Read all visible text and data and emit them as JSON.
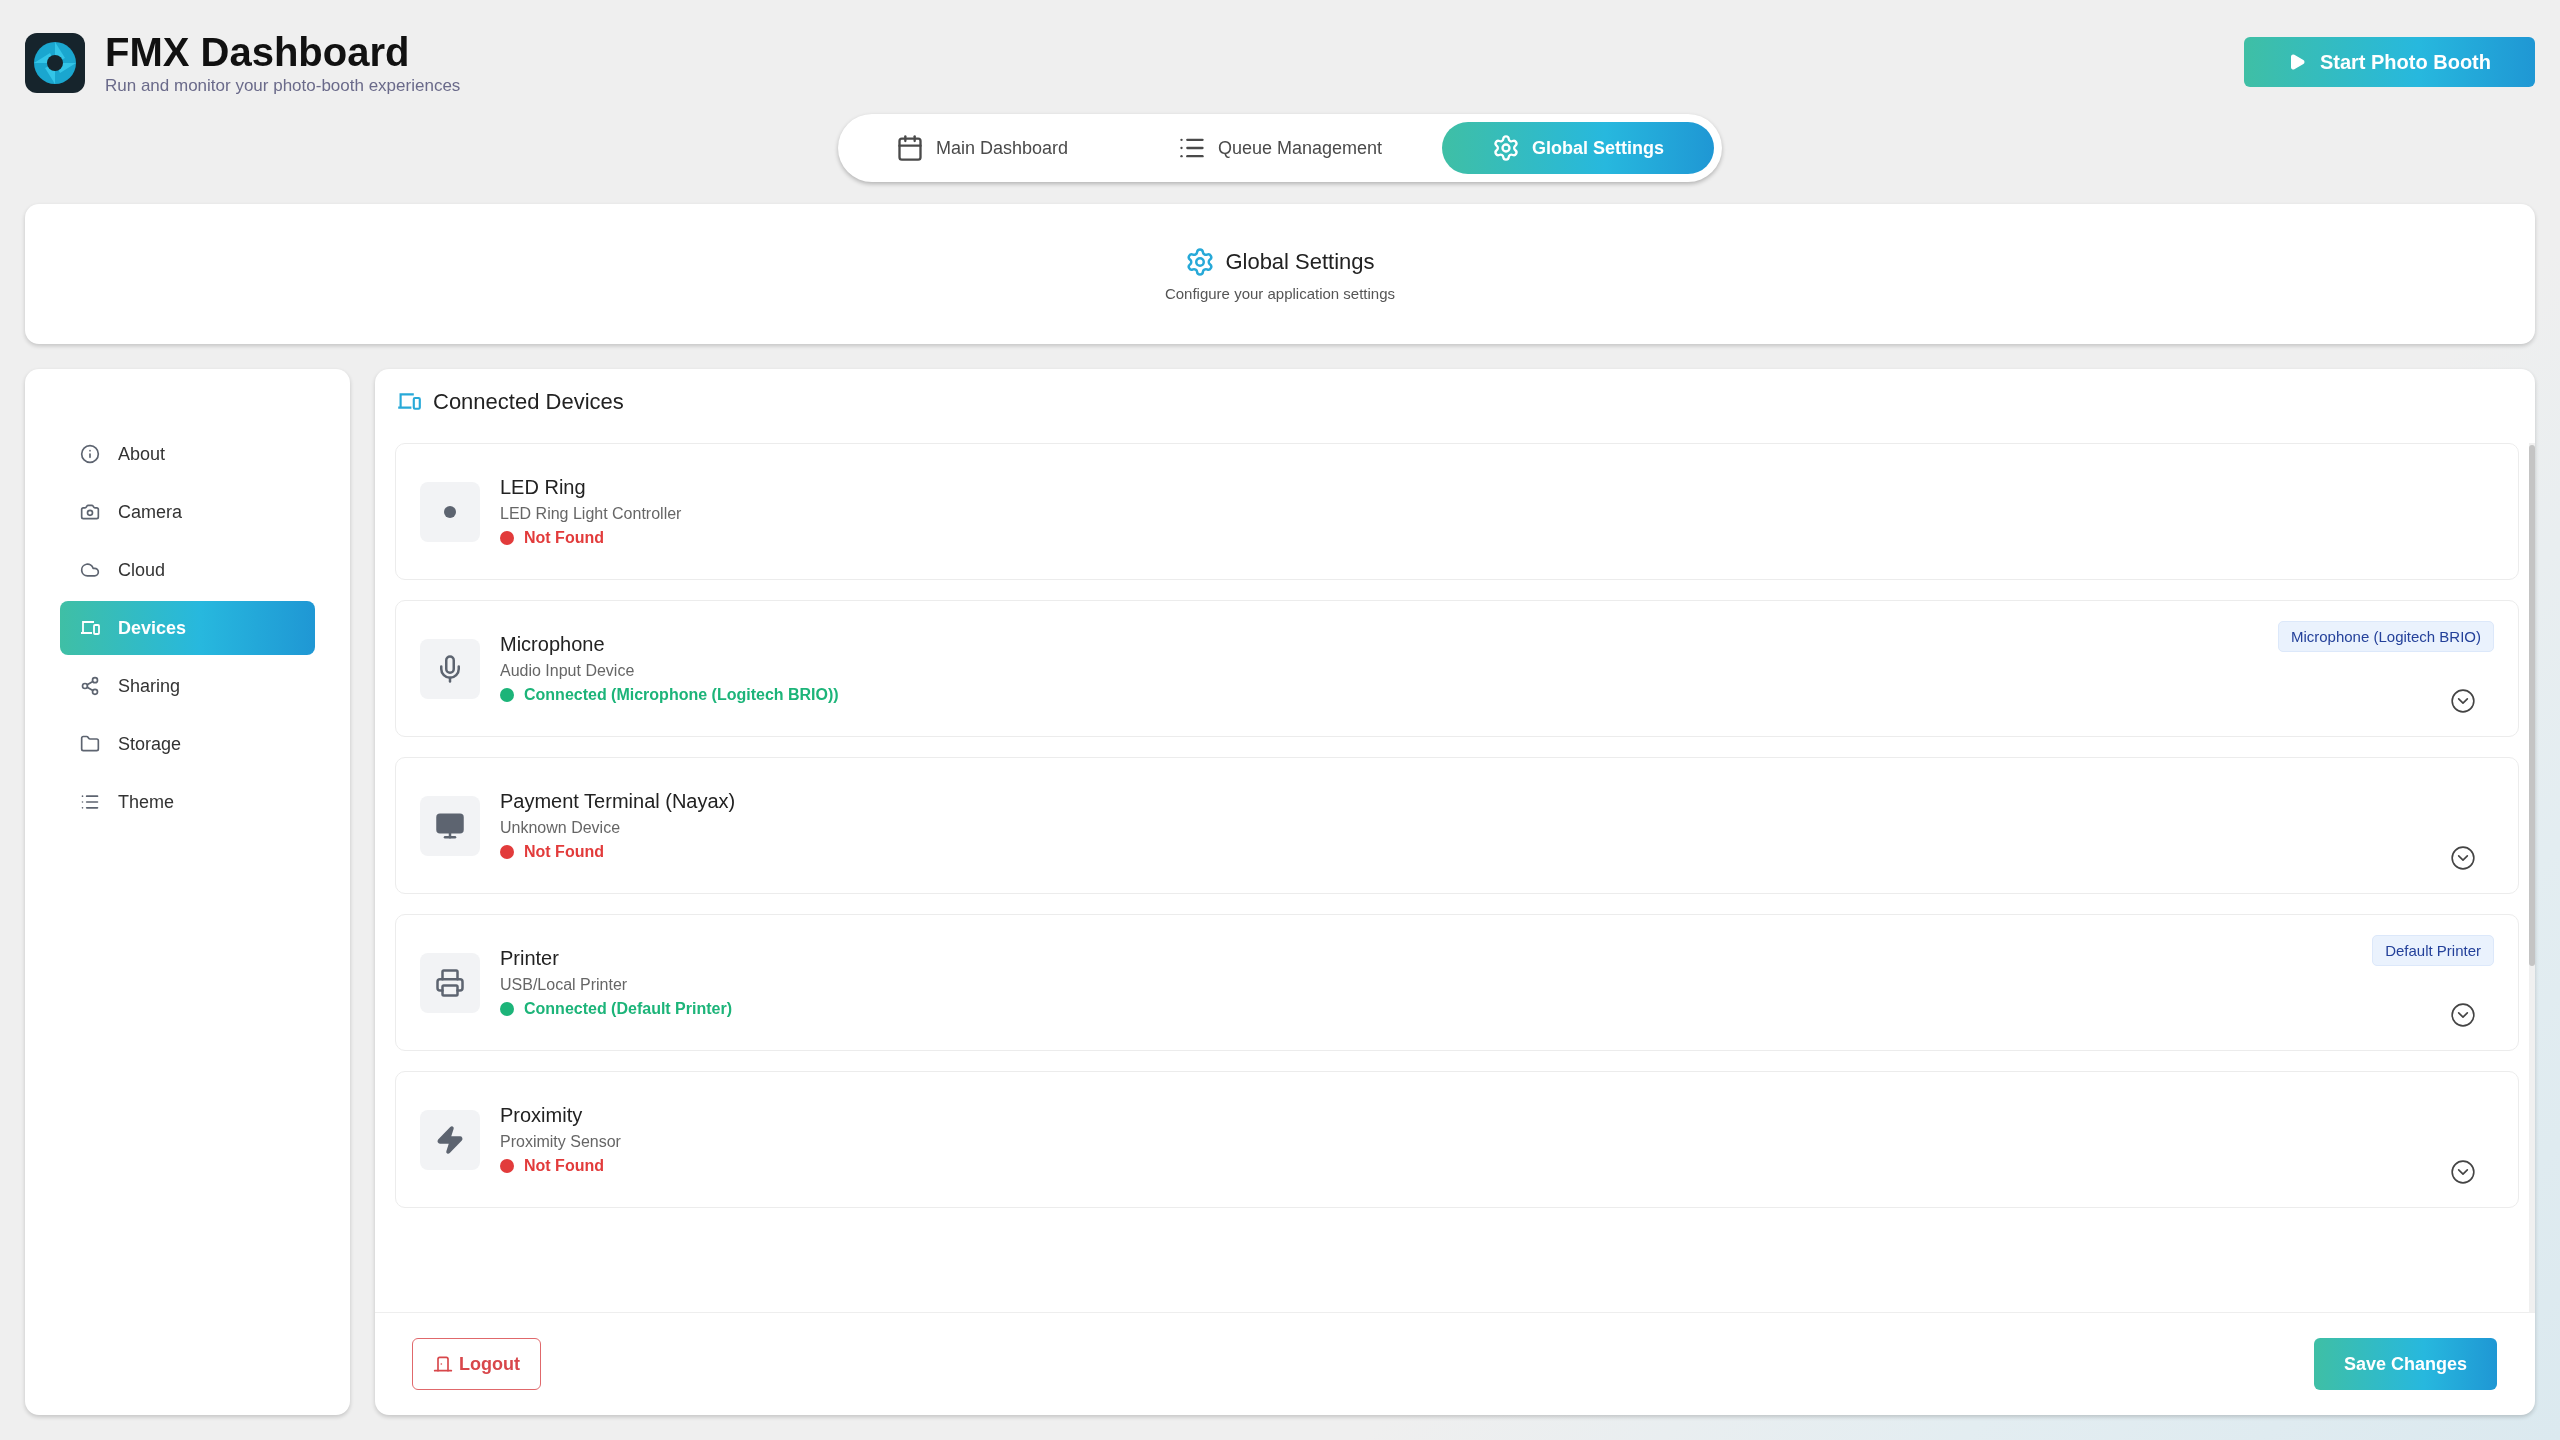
{
  "header": {
    "title": "FMX Dashboard",
    "subtitle": "Run and monitor your photo-booth experiences",
    "start_button": "Start Photo Booth"
  },
  "tabs": [
    {
      "label": "Main Dashboard",
      "selected": false
    },
    {
      "label": "Queue Management",
      "selected": false
    },
    {
      "label": "Global Settings",
      "selected": true
    }
  ],
  "settings_header": {
    "title": "Global Settings",
    "subtitle": "Configure your application settings"
  },
  "sidebar": {
    "items": [
      {
        "label": "About",
        "selected": false
      },
      {
        "label": "Camera",
        "selected": false
      },
      {
        "label": "Cloud",
        "selected": false
      },
      {
        "label": "Devices",
        "selected": true
      },
      {
        "label": "Sharing",
        "selected": false
      },
      {
        "label": "Storage",
        "selected": false
      },
      {
        "label": "Theme",
        "selected": false
      }
    ]
  },
  "devices_panel": {
    "title": "Connected Devices",
    "devices": [
      {
        "name": "LED Ring",
        "type": "LED Ring Light Controller",
        "status": "Not Found",
        "connected": false,
        "expandable": false
      },
      {
        "name": "Microphone",
        "type": "Audio Input Device",
        "status": "Connected (Microphone (Logitech BRIO))",
        "connected": true,
        "badge": "Microphone (Logitech BRIO)",
        "expandable": true
      },
      {
        "name": "Payment Terminal (Nayax)",
        "type": "Unknown Device",
        "status": "Not Found",
        "connected": false,
        "expandable": true
      },
      {
        "name": "Printer",
        "type": "USB/Local Printer",
        "status": "Connected (Default Printer)",
        "connected": true,
        "badge": "Default Printer",
        "expandable": true
      },
      {
        "name": "Proximity",
        "type": "Proximity Sensor",
        "status": "Not Found",
        "connected": false,
        "expandable": true
      }
    ]
  },
  "footer": {
    "logout": "Logout",
    "save": "Save Changes"
  }
}
